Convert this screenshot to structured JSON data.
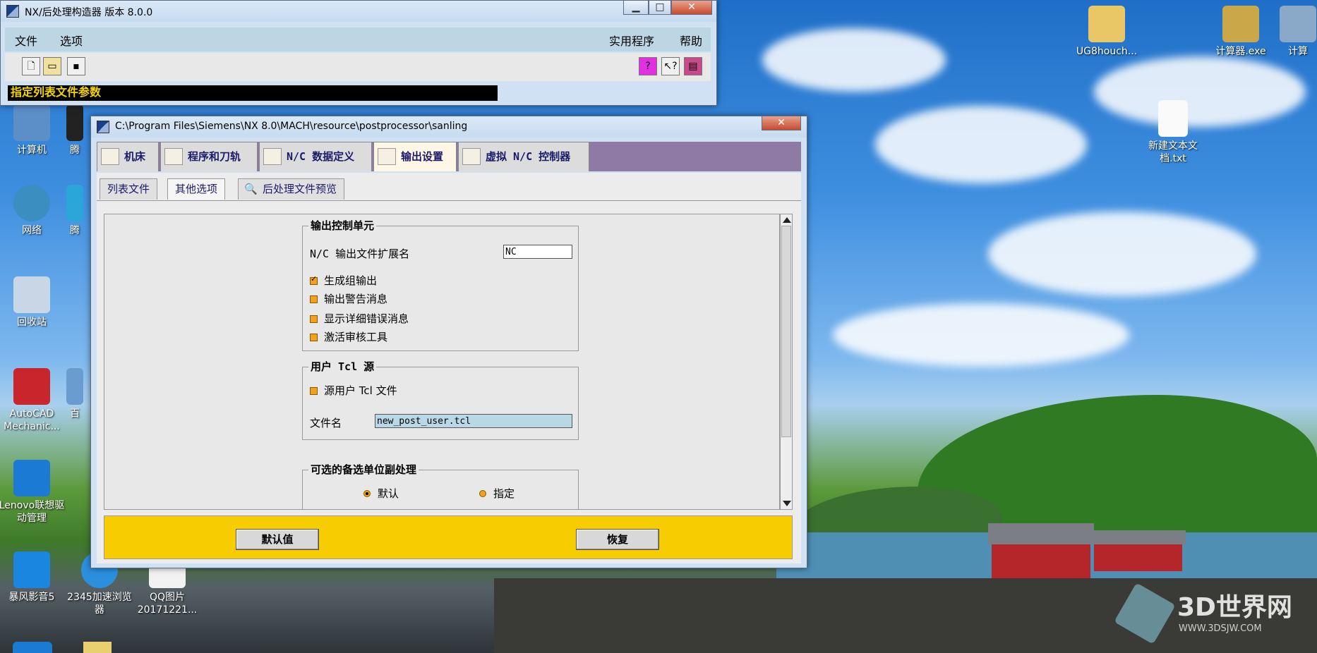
{
  "desktop": {
    "icons": [
      {
        "label": "计算机"
      },
      {
        "label": "腾"
      },
      {
        "label": "网络"
      },
      {
        "label": "腾"
      },
      {
        "label": "回收站"
      },
      {
        "label": "AutoCAD Mechanic..."
      },
      {
        "label": "百"
      },
      {
        "label": "Lenovo联想驱动管理"
      },
      {
        "label": "暴风影音5"
      },
      {
        "label": "2345加速浏览器"
      },
      {
        "label": "QQ图片20171221..."
      },
      {
        "label": "UG8houch..."
      },
      {
        "label": "计算器.exe"
      },
      {
        "label": "计算"
      },
      {
        "label": "新建文本文档.txt"
      }
    ],
    "watermark": {
      "text": "3D世界网",
      "url": "WWW.3DSJW.COM"
    }
  },
  "main_window": {
    "title": "NX/后处理构造器 版本 8.0.0",
    "menu_left": [
      "文件",
      "选项"
    ],
    "menu_right": [
      "实用程序",
      "帮助"
    ],
    "status": "指定列表文件参数"
  },
  "dialog": {
    "title": "C:\\Program Files\\Siemens\\NX 8.0\\MACH\\resource\\postprocessor\\sanling",
    "tabs": [
      "机床",
      "程序和刀轨",
      "N/C 数据定义",
      "输出设置",
      "虚拟 N/C 控制器"
    ],
    "subtabs": [
      "列表文件",
      "其他选项",
      "后处理文件预览"
    ],
    "output_group": {
      "title": "输出控制单元",
      "ext_label": "N/C 输出文件扩展名",
      "ext_value": "NC",
      "checks": [
        {
          "label": "生成组输出",
          "checked": true
        },
        {
          "label": "输出警告消息",
          "checked": false
        },
        {
          "label": "显示详细错误消息",
          "checked": false
        },
        {
          "label": "激活审核工具",
          "checked": false
        }
      ]
    },
    "tcl_group": {
      "title": "用户 Tcl 源",
      "check_label": "源用户 Tcl 文件",
      "file_label": "文件名",
      "file_value": "new_post_user.tcl"
    },
    "alt_group": {
      "title": "可选的备选单位副处理",
      "radio_default": "默认",
      "radio_specify": "指定"
    },
    "buttons": {
      "default": "默认值",
      "restore": "恢复"
    }
  }
}
